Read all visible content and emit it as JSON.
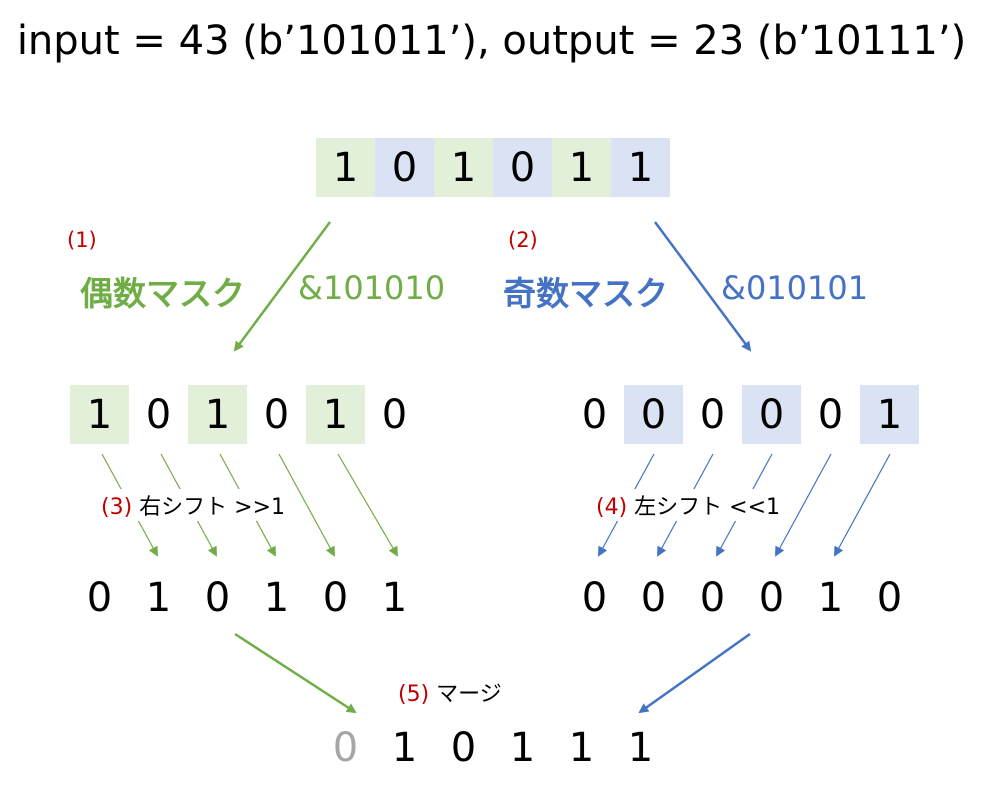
{
  "title": "input = 43 (b’101011’), output = 23 (b’10111’)",
  "input_bits": [
    "1",
    "0",
    "1",
    "0",
    "1",
    "1"
  ],
  "even_masked": [
    "1",
    "0",
    "1",
    "0",
    "1",
    "0"
  ],
  "odd_masked": [
    "0",
    "0",
    "0",
    "0",
    "0",
    "1"
  ],
  "shift_right_result": [
    "0",
    "1",
    "0",
    "1",
    "0",
    "1"
  ],
  "shift_left_result": [
    "0",
    "0",
    "0",
    "0",
    "1",
    "0"
  ],
  "merged": [
    "0",
    "1",
    "0",
    "1",
    "1",
    "1"
  ],
  "steps": {
    "s1": {
      "num": "(1)",
      "label": "偶数マスク",
      "op": "&101010"
    },
    "s2": {
      "num": "(2)",
      "label": "奇数マスク",
      "op": "&010101"
    },
    "s3": {
      "num": "(3)",
      "label": "右シフト >>1"
    },
    "s4": {
      "num": "(4)",
      "label": "左シフト <<1"
    },
    "s5": {
      "num": "(5)",
      "label": "マージ"
    }
  },
  "colors": {
    "even": "#70ad47",
    "odd": "#4472c4",
    "even_fill": "#e2f0d9",
    "odd_fill": "#dae3f3",
    "step_number": "#c00000",
    "leading_zero": "#a6a6a6"
  }
}
